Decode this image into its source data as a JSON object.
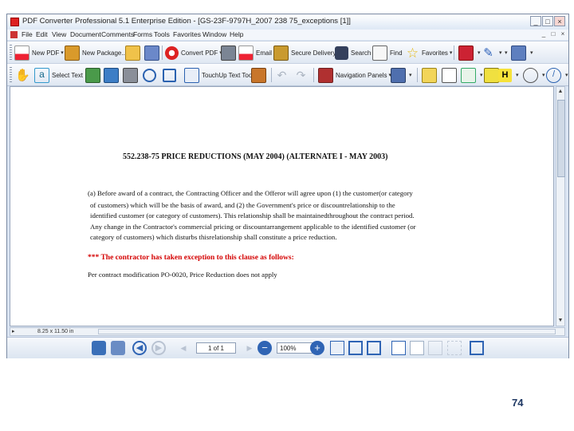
{
  "window": {
    "title": "PDF Converter Professional 5.1 Enterprise Edition - [GS-23F-9797H_2007 238 75_exceptions [1]]",
    "controls": [
      "_",
      "□",
      "×"
    ]
  },
  "menubar": {
    "items": [
      "File",
      "Edit",
      "View",
      "Document",
      "Comments",
      "Forms",
      "Tools",
      "Favorites",
      "Window",
      "Help"
    ],
    "mdi_controls": [
      "_",
      "□",
      "×"
    ]
  },
  "toolbar1": {
    "new_pdf": "New PDF",
    "new_package": "New Package...",
    "convert_pdf": "Convert PDF",
    "email": "Email",
    "secure_delivery": "Secure Delivery",
    "search": "Search",
    "find": "Find",
    "favorites": "Favorites"
  },
  "toolbar2": {
    "select_text": "Select Text",
    "touchup_text": "TouchUp Text Tool",
    "navigation_panels": "Navigation Panels"
  },
  "document": {
    "heading": "552.238-75 PRICE REDUCTIONS (MAY 2004) (ALTERNATE I - MAY 2003)",
    "paragraph_lines": [
      "(a) Before award of a contract, the Contracting Officer and the Offeror will agree upon (1) the customer(or category",
      "of customers) which will be the basis of award, and (2) the Government's price or discountrelationship to the",
      "identified customer (or category of customers). This relationship shall be maintainedthroughout the contract period.",
      "Any change in the Contractor's commercial pricing or discountarrangement applicable to the identified customer (or",
      "category of customers) which disturbs thisrelationship shall constitute a price reduction."
    ],
    "exception_note": "*** The contractor has taken exception to this clause as follows:",
    "exception_text": "Per contract modification PO-0020, Price Reduction does not apply"
  },
  "statusbar": {
    "page_size": "8.25 x 11.50 in"
  },
  "navbar": {
    "page_indicator": "1 of 1",
    "zoom_level": "100%"
  },
  "slide": {
    "number": "74"
  },
  "colors": {
    "accent_red": "#d40000",
    "window_frame": "#dbe5f3",
    "slide_number": "#1f3864"
  }
}
